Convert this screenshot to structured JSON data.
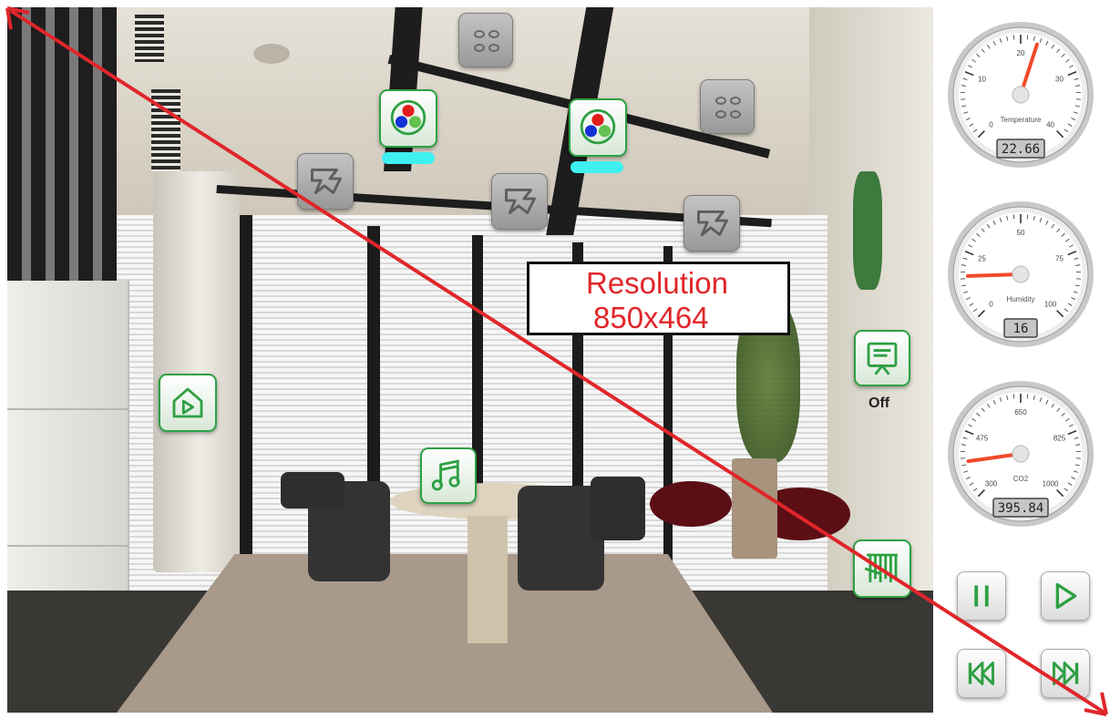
{
  "resolution": {
    "line1": "Resolution",
    "line2": "850x464"
  },
  "screen_toggle": {
    "label": "Off"
  },
  "gauges": [
    {
      "name": "Temperature",
      "value": 22.66,
      "display": "22.66",
      "min": 0,
      "max": 40,
      "ticks": [
        "0",
        "10",
        "20",
        "30",
        "40"
      ]
    },
    {
      "name": "Humidity",
      "value": 16,
      "display": "16",
      "min": 0,
      "max": 100,
      "ticks": [
        "0",
        "25",
        "50",
        "75",
        "100"
      ]
    },
    {
      "name": "CO2",
      "value": 395.84,
      "display": "395.84",
      "min": 300,
      "max": 1000,
      "ticks": [
        "300",
        "475",
        "650",
        "825",
        "1000"
      ]
    }
  ],
  "icons": {
    "light_rgb": "rgb-light-icon",
    "ceiling_light": "ceiling-light-icon",
    "vent": "vent-icon",
    "home": "home-play-icon",
    "music": "music-icon",
    "projector": "projector-screen-icon",
    "blinds": "blinds-icon"
  },
  "media_controls": [
    "pause-icon",
    "play-icon",
    "rewind-icon",
    "fast-forward-icon"
  ],
  "colors": {
    "accent": "#2ea043",
    "arrow": "#e0262a",
    "indicator": "#3ff0f0"
  }
}
